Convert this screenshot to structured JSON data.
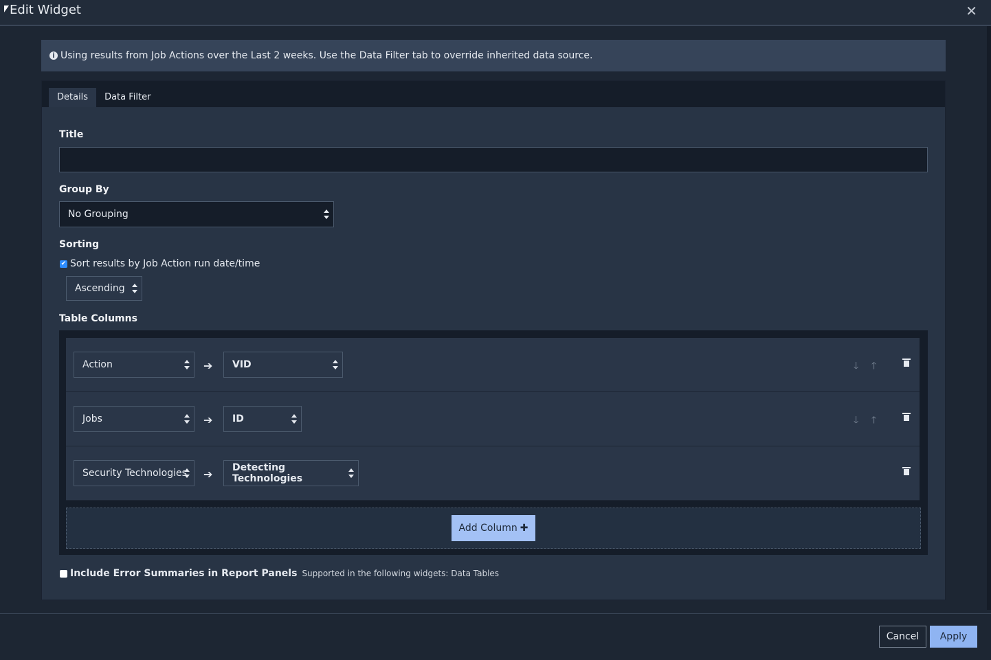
{
  "dialog": {
    "title": "Edit Widget"
  },
  "info": {
    "text": "Using results from Job Actions over the Last 2 weeks. Use the Data Filter tab to override inherited data source."
  },
  "tabs": [
    {
      "label": "Details",
      "active": true
    },
    {
      "label": "Data Filter",
      "active": false
    }
  ],
  "form": {
    "title_label": "Title",
    "title_value": "",
    "group_by_label": "Group By",
    "group_by_value": "No Grouping",
    "sorting_label": "Sorting",
    "sort_checkbox_label": "Sort results by Job Action run date/time",
    "sort_checked": true,
    "sort_order": "Ascending",
    "table_columns_label": "Table Columns"
  },
  "columns": [
    {
      "source": "Action",
      "field": "VID",
      "can_reorder": true
    },
    {
      "source": "Jobs",
      "field": "ID",
      "can_reorder": true
    },
    {
      "source": "Security Technologies",
      "field": "Detecting Technologies",
      "can_reorder": false
    }
  ],
  "add_column_label": "Add Column",
  "error_summary": {
    "label": "Include Error Summaries in Report Panels",
    "note": "Supported in the following widgets: Data Tables",
    "checked": false
  },
  "footer": {
    "cancel_label": "Cancel",
    "apply_label": "Apply"
  },
  "colors": {
    "accent": "#8fb4f2",
    "background": "#1d2633",
    "panel": "#283445",
    "checkbox_checked": "#2d8cff"
  }
}
